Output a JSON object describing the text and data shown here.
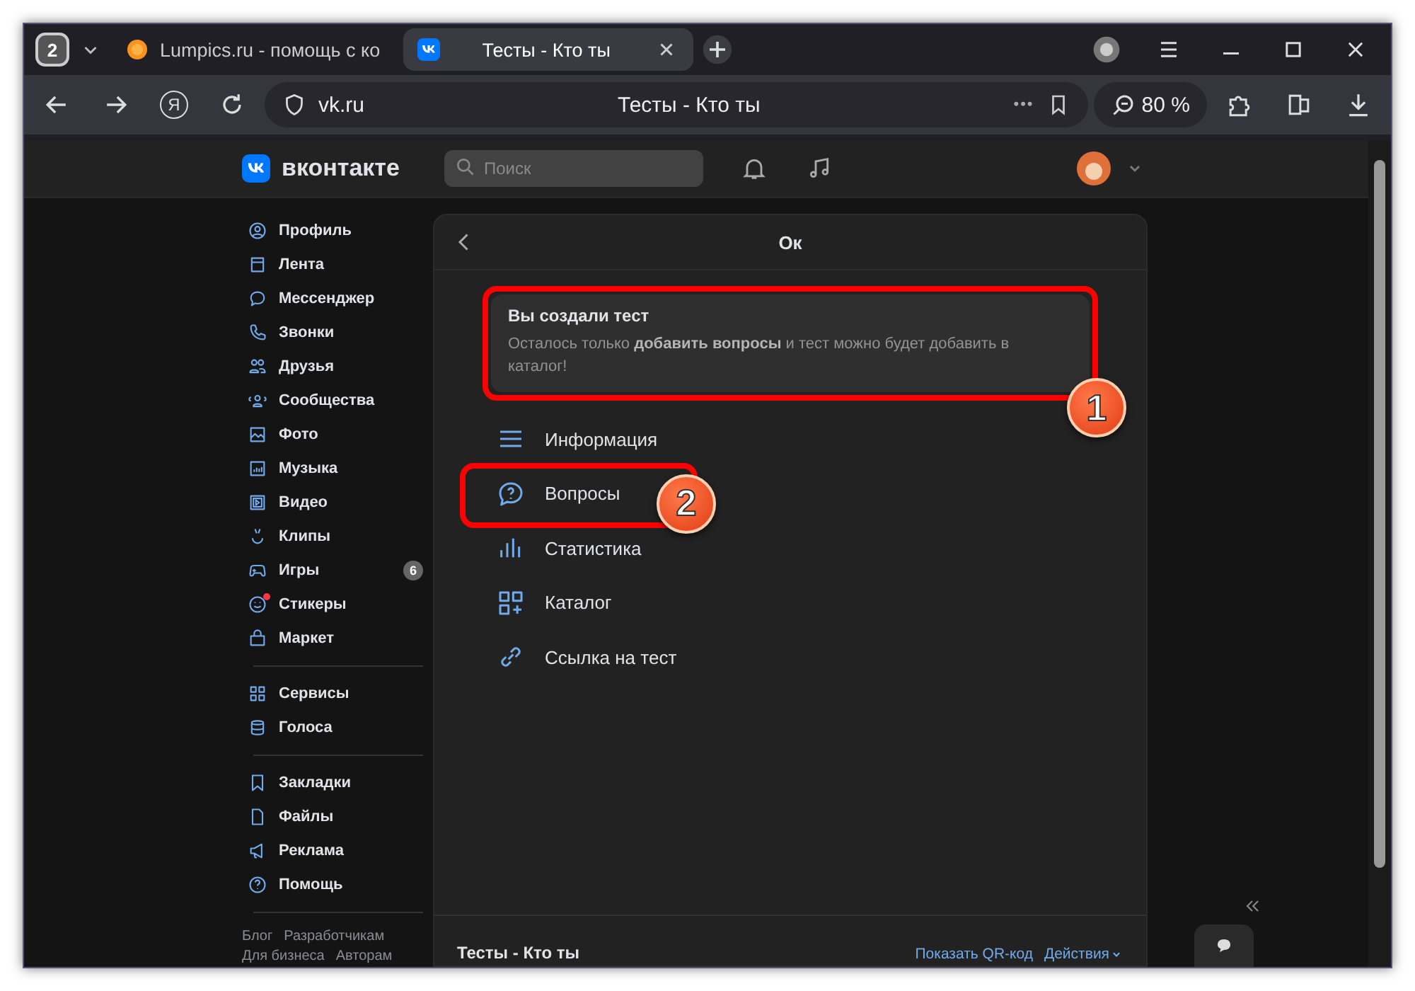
{
  "browser": {
    "tab_count": "2",
    "tabs": [
      {
        "title": "Lumpics.ru - помощь с ко",
        "selected": false
      },
      {
        "title": "Тесты - Кто ты",
        "selected": true
      }
    ],
    "yandex_button": "Я",
    "address": "vk.ru",
    "page_title": "Тесты - Кто ты",
    "more": "•••",
    "zoom": "80 %"
  },
  "header": {
    "logo": "вконтакте",
    "search": {
      "placeholder": "Поиск"
    }
  },
  "sidebar": {
    "groups": [
      [
        {
          "label": "Профиль",
          "unread_dot": false
        },
        {
          "label": "Лента",
          "unread_dot": false
        },
        {
          "label": "Мессенджер",
          "unread_dot": false
        },
        {
          "label": "Звонки",
          "unread_dot": false
        },
        {
          "label": "Друзья",
          "unread_dot": false
        },
        {
          "label": "Сообщества",
          "unread_dot": false
        },
        {
          "label": "Фото",
          "unread_dot": false
        },
        {
          "label": "Музыка",
          "unread_dot": false
        },
        {
          "label": "Видео",
          "unread_dot": false
        },
        {
          "label": "Клипы",
          "unread_dot": false
        },
        {
          "label": "Игры",
          "unread_dot": false,
          "badge": "6"
        },
        {
          "label": "Стикеры",
          "unread_dot": true
        },
        {
          "label": "Маркет",
          "unread_dot": false
        }
      ],
      [
        {
          "label": "Сервисы",
          "unread_dot": false
        },
        {
          "label": "Голоса",
          "unread_dot": false
        }
      ],
      [
        {
          "label": "Закладки",
          "unread_dot": false
        },
        {
          "label": "Файлы",
          "unread_dot": false
        },
        {
          "label": "Реклама",
          "unread_dot": false
        },
        {
          "label": "Помощь",
          "unread_dot": false
        }
      ]
    ],
    "footer_links": [
      "Блог",
      "Разработчикам",
      "Для бизнеса",
      "Авторам"
    ]
  },
  "panel": {
    "title": "Ок",
    "notice": {
      "title": "Вы создали тест",
      "text": "Осталось только **добавить вопросы** и тест можно будет добавить в каталог!",
      "callout": "1"
    },
    "menu": [
      {
        "label": "Информация"
      },
      {
        "label": "Вопросы",
        "callout": "2"
      },
      {
        "label": "Статистика"
      },
      {
        "label": "Каталог"
      },
      {
        "label": "Ссылка на тест"
      }
    ],
    "footer": {
      "title": "Тесты - Кто ты",
      "qr_link": "Показать QR-код",
      "actions": "Действия"
    }
  }
}
